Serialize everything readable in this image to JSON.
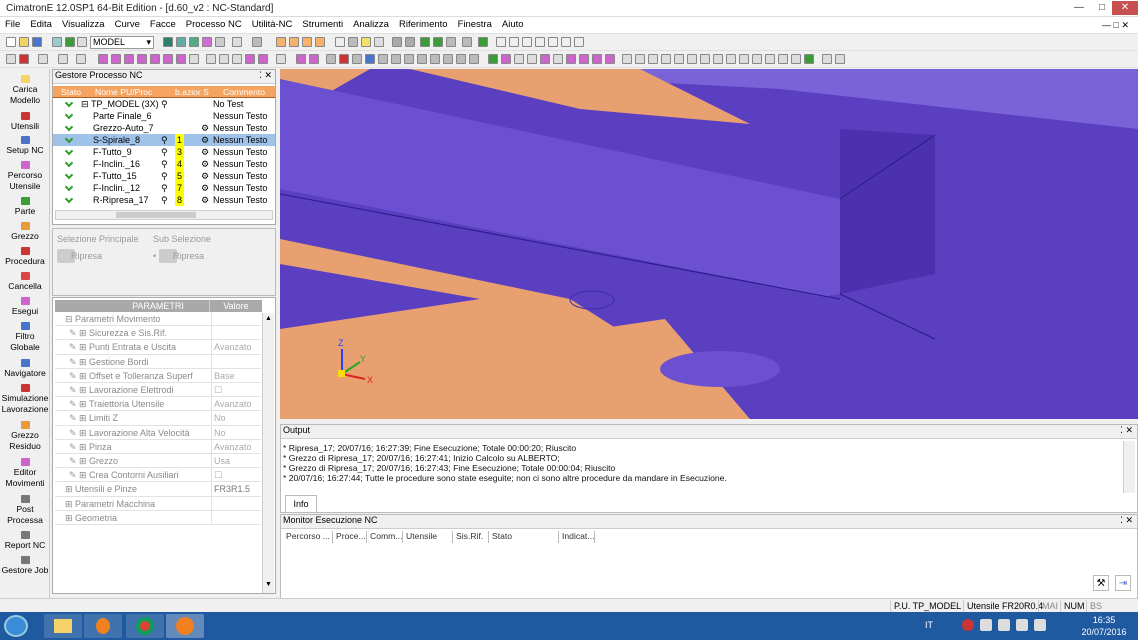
{
  "title": "CimatronE 12.0SP1  64-Bit Edition - [d.60_v2 : NC-Standard]",
  "menu": [
    "File",
    "Edita",
    "Visualizza",
    "Curve",
    "Facce",
    "Processo NC",
    "Utilità-NC",
    "Strumenti",
    "Analizza",
    "Riferimento",
    "Finestra",
    "Aiuto"
  ],
  "toolbar": {
    "model_select": "MODEL"
  },
  "left_tools": [
    "Carica Modello",
    "Utensili",
    "Setup NC",
    "Percorso Utensile",
    "Parte",
    "Grezzo",
    "Procedura",
    "Cancella",
    "Esegui",
    "Filtro Globale",
    "Navigatore",
    "Simulazione Lavorazione",
    "Grezzo Residuo",
    "Editor Movimenti",
    "Post Processa",
    "Report NC",
    "Gestore Job"
  ],
  "proc_panel": {
    "title": "Gestore Processo NC",
    "headers": [
      "Stato",
      "Nome PU/Proc",
      "b.azior S",
      "Commento"
    ],
    "rows": [
      {
        "name": "TP_MODEL (3X)",
        "num": "",
        "comment": "No Test"
      },
      {
        "name": "Parte Finale_6",
        "num": "",
        "comment": "Nessun Testo"
      },
      {
        "name": "Grezzo-Auto_7",
        "num": "",
        "comment": "Nessun Testo"
      },
      {
        "name": "S-Spirale_8",
        "num": "1",
        "comment": "Nessun Testo"
      },
      {
        "name": "F-Tutto_9",
        "num": "3",
        "comment": "Nessun Testo"
      },
      {
        "name": "F-Inclin._16",
        "num": "4",
        "comment": "Nessun Testo"
      },
      {
        "name": "F-Tutto_15",
        "num": "5",
        "comment": "Nessun Testo"
      },
      {
        "name": "F-Inclin._12",
        "num": "7",
        "comment": "Nessun Testo"
      },
      {
        "name": "R-Ripresa_17",
        "num": "8",
        "comment": "Nessun Testo"
      }
    ]
  },
  "selection": {
    "main": "Selezione Principale",
    "sub": "Sub Selezione",
    "item1": "Ripresa",
    "item2": "Ripresa"
  },
  "params": {
    "header": "PARAMETRI",
    "value_header": "Valore",
    "rows": [
      {
        "label": "Parametri Movimento",
        "value": "",
        "indent": 0
      },
      {
        "label": "Sicurezza e Sis.Rif.",
        "value": "",
        "indent": 1
      },
      {
        "label": "Punti Entrata e Uscita",
        "value": "Avanzato",
        "indent": 1
      },
      {
        "label": "Gestione Bordi",
        "value": "",
        "indent": 1
      },
      {
        "label": "Offset e Tolleranza Superf",
        "value": "Base",
        "indent": 1
      },
      {
        "label": "Lavorazione Elettrodi",
        "value": "☐",
        "indent": 1
      },
      {
        "label": "Traiettoria Utensile",
        "value": "Avanzato",
        "indent": 1
      },
      {
        "label": "Limiti Z",
        "value": "No",
        "indent": 1
      },
      {
        "label": "Lavorazione Alta Velocità",
        "value": "No",
        "indent": 1
      },
      {
        "label": "Pinza",
        "value": "Avanzato",
        "indent": 1
      },
      {
        "label": "Grezzo",
        "value": "Usa",
        "indent": 1
      },
      {
        "label": "Crea Contorni Ausiliari",
        "value": "☐",
        "indent": 1
      },
      {
        "label": "Utensili e Pinze",
        "value": "FR3R1.5",
        "indent": 0
      },
      {
        "label": "Parametri Macchina",
        "value": "",
        "indent": 0
      },
      {
        "label": "Geometria",
        "value": "",
        "indent": 0
      }
    ]
  },
  "output": {
    "title": "Output",
    "tab": "Info",
    "lines": [
      "* Ripresa_17; 20/07/16; 16:27:39; Fine Esecuzione; Totale 00:00:20; Riuscito",
      "* Grezzo di Ripresa_17; 20/07/16; 16:27:41; Inizio Calcolo su ALBERTO;",
      "* Grezzo di Ripresa_17; 20/07/16; 16:27:43; Fine Esecuzione; Totale 00:00:04; Riuscito",
      "* 20/07/16; 16:27:44; Tutte le procedure sono state eseguite; non ci sono altre procedure da mandare in Esecuzione."
    ]
  },
  "monitor": {
    "title": "Monitor Esecuzione NC",
    "columns": [
      "Percorso ...",
      "Proce...",
      "Comm...",
      "Utensile",
      "Sis.Rif.",
      "Stato",
      "Indicat..."
    ]
  },
  "status": {
    "pu": "P.U. TP_MODEL",
    "tool": "Utensile  FR20R0.4",
    "mai": "MAI",
    "num": "NUM",
    "bs": "BS"
  },
  "taskbar": {
    "lang": "IT",
    "time": "16:35",
    "date": "20/07/2016"
  },
  "axes": {
    "x": "X",
    "y": "Y",
    "z": "Z"
  },
  "colors": {
    "accent": "#f4a460",
    "surface_blue": "#5a3fc0",
    "surface_orange": "#e8a070"
  }
}
